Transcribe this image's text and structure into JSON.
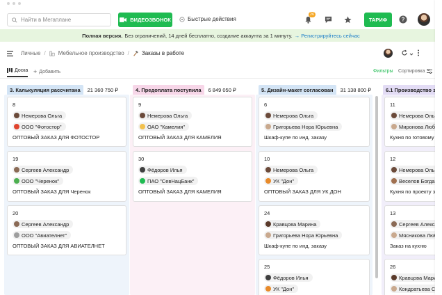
{
  "search": {
    "placeholder": "Найти в Мегаплане"
  },
  "topbar": {
    "video_label": "ВИДЕОЗВОНОК",
    "quick_actions_label": "Быстрые действия",
    "notifications_count": "26",
    "tariff_label": "ТАРИФ"
  },
  "promo": {
    "bold": "Полная версия.",
    "text": "Без ограничений, 14 дней бесплатно, создание аккаунта за 1 минуту.",
    "link": "→ Регистрируйтесь сейчас"
  },
  "breadcrumbs": {
    "items": [
      "Личные",
      "Мебельное производство",
      "Заказы в работе"
    ]
  },
  "tabs": {
    "board": "Доска",
    "add": "Добавить",
    "filters": "Фильтры",
    "sort": "Сортировка"
  },
  "colors": {
    "accent": "#1fbb51",
    "promo_bg": "#e7f5df",
    "link": "#1d7ec9",
    "col1_bg": "#eef4fb",
    "col2_bg": "#fcf0f6",
    "col3_bg": "#eef4fb",
    "col4_bg": "#f1eefa"
  },
  "columns": [
    {
      "title": "3. Калькуляция рассчитана",
      "sum": "21 360 750 ₽",
      "cards": [
        {
          "num": "8",
          "person": "Немерова Ольга",
          "company": "ООО \"Фотостор\"",
          "title": "ОПТОВЫЙ ЗАКАЗ ДЛЯ ФОТОСТОР"
        },
        {
          "num": "19",
          "person": "Сергеев Александр",
          "company": "ООО \"Черенок\"",
          "title": "ОПТОВЫЙ ЗАКАЗ ДЛЯ Черенок"
        },
        {
          "num": "20",
          "person": "Сергеев Александр",
          "company": "ООО \"Авиателнет\"",
          "title": "ОПТОВЫЙ ЗАКАЗ ДЛЯ АВИАТЕЛНЕТ"
        }
      ]
    },
    {
      "title": "4. Предоплата поступила",
      "sum": "6 849 050 ₽",
      "cards": [
        {
          "num": "9",
          "person": "Немерова Ольга",
          "company": "ОАО \"Камелия\"",
          "title": "ОПТОВЫЙ ЗАКАЗ ДЛЯ КАМЕЛИЯ"
        },
        {
          "num": "30",
          "person": "Фёдоров Илья",
          "company": "ПАО \"СевНацБанк\"",
          "title": "ОПТОВЫЙ ЗАКАЗ ДЛЯ КАМЕЛИЯ"
        }
      ]
    },
    {
      "title": "5. Дизайн-макет согласован",
      "sum": "31 138 800 ₽",
      "cards": [
        {
          "num": "6",
          "person": "Немерова Ольга",
          "company": "Григорьева Нора Юрьевна",
          "title": "Шкаф-купе по инд. заказу"
        },
        {
          "num": "10",
          "person": "Немерова Ольга",
          "company": "УК \"Дон\"",
          "title": "ОПТОВЫЙ ЗАКАЗ ДЛЯ УК ДОН"
        },
        {
          "num": "24",
          "person": "Кравцова Марина",
          "company": "Григорьева Нора Юрьевна",
          "title": "Шкаф-купе по инд. заказу"
        },
        {
          "num": "25",
          "person": "Фёдоров Илья",
          "company": "УК \"Дон\"",
          "title": ""
        }
      ]
    },
    {
      "title": "6.1 Производство за",
      "sum": "",
      "cards": [
        {
          "num": "11",
          "person": "Немерова Ольга",
          "company": "Миронова Любов",
          "title": "Кухня по готовому"
        },
        {
          "num": "12",
          "person": "Немерова Ольга",
          "company": "Веселов Богдан",
          "title": "Кухня по проекту за"
        },
        {
          "num": "13",
          "person": "Сергеев Алекса",
          "company": "Мясникова Люб",
          "title": "Заказ на кухню"
        },
        {
          "num": "26",
          "person": "Кравцова Мари",
          "company": "Кондратьева Св",
          "title": ""
        }
      ]
    }
  ]
}
